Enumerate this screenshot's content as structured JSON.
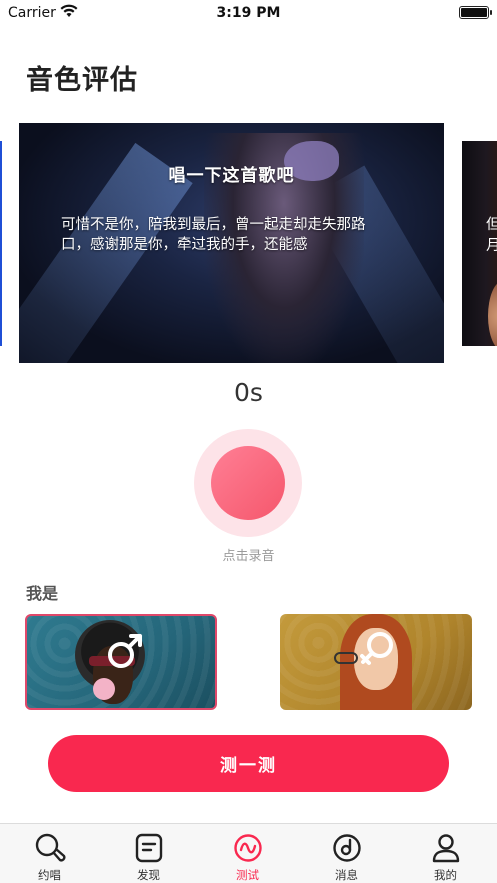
{
  "status_bar": {
    "carrier": "Carrier",
    "time": "3:19 PM"
  },
  "page": {
    "title": "音色评估"
  },
  "carousel": {
    "current": {
      "prompt": "唱一下这首歌吧",
      "lyrics": "可惜不是你，陪我到最后，曾一起走却走失那路口，感谢那是你，牵过我的手，还能感"
    },
    "next_preview": "但\n月"
  },
  "recorder": {
    "timer": "0s",
    "hint": "点击录音"
  },
  "gender": {
    "label": "我是",
    "options": [
      {
        "value": "male",
        "symbol": "male-symbol-icon"
      },
      {
        "value": "female",
        "symbol": "female-symbol-icon"
      }
    ],
    "selected": "male"
  },
  "cta": {
    "label": "测一测"
  },
  "tab_bar": {
    "items": [
      {
        "label": "约唱",
        "icon": "search-sing-icon"
      },
      {
        "label": "发现",
        "icon": "discover-icon"
      },
      {
        "label": "测试",
        "icon": "test-wave-icon"
      },
      {
        "label": "消息",
        "icon": "message-disc-icon"
      },
      {
        "label": "我的",
        "icon": "profile-icon"
      }
    ],
    "active_index": 2
  },
  "colors": {
    "accent": "#f9284f",
    "record": "#f5576c",
    "record_ring": "#fde3e8"
  }
}
